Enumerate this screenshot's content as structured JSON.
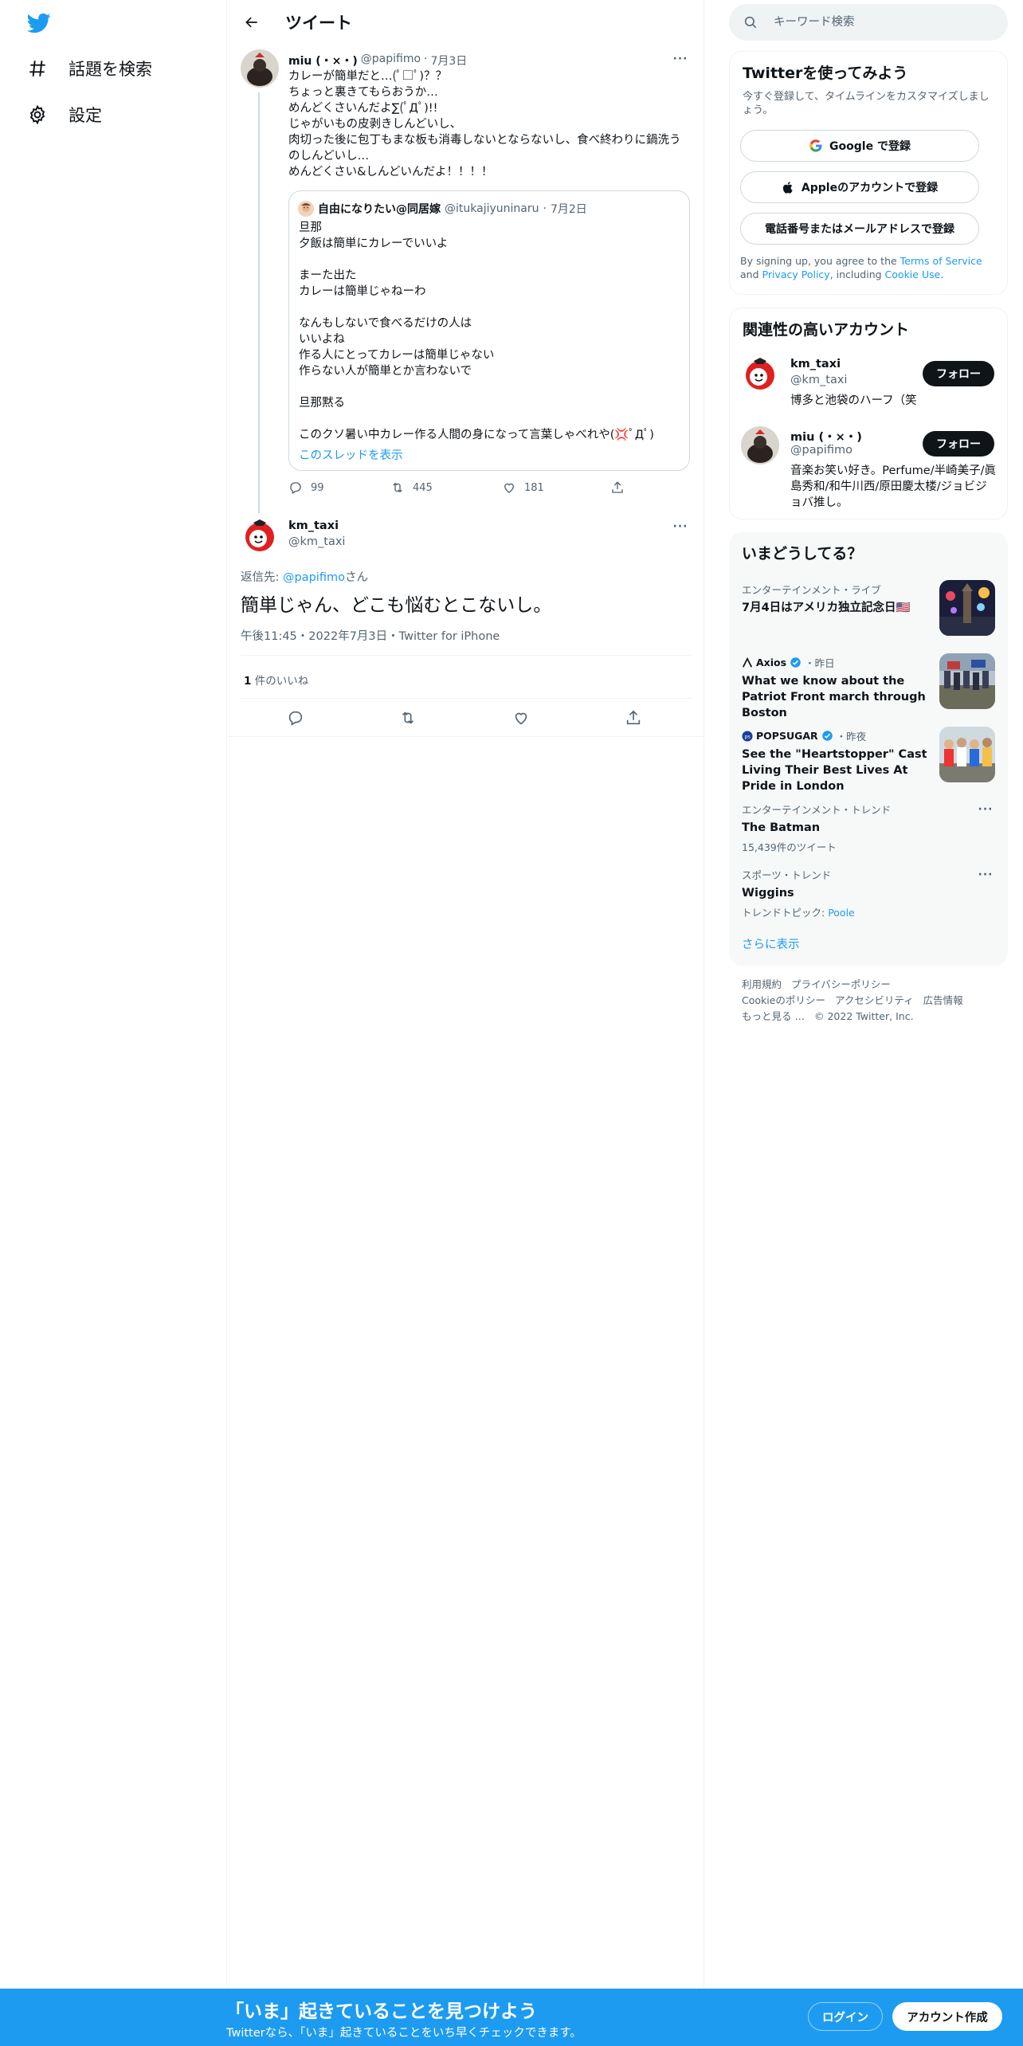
{
  "nav": {
    "explore_label": "話題を検索",
    "settings_label": "設定"
  },
  "header": {
    "title": "ツイート"
  },
  "tweet1": {
    "name": "miu (・×・)",
    "handle": "@papifimo",
    "date": "7月3日",
    "text": "カレーが簡単だと…(ﾟ□ﾟ)？？\nちょっと裏きてもらおうか…\nめんどくさいんだよ∑(ﾟДﾟ)!!\nじゃがいもの皮剥きしんどいし、\n肉切った後に包丁もまな板も消毒しないとならないし、食べ終わりに鍋洗うのしんどいし…\nめんどくさい&しんどいんだよ！！！！",
    "quote": {
      "name": "自由になりたい@同居嫁",
      "handle": "@itukajiyuninaru",
      "date": "7月2日",
      "text": "旦那\n夕飯は簡単にカレーでいいよ\n\nまーた出た\nカレーは簡単じゃねーわ\n\nなんもしないで食べるだけの人は\nいいよね\n作る人にとってカレーは簡単じゃない\n作らない人が簡単とか言わないで\n\n旦那黙る\n\nこのクソ暑い中カレー作る人間の身になって言葉しゃべれや(💢ﾟДﾟ)",
      "show_thread": "このスレッドを表示"
    },
    "replies": "99",
    "retweets": "445",
    "likes": "181"
  },
  "tweet2": {
    "name": "km_taxi",
    "handle": "@km_taxi",
    "reply_prefix": "返信先: ",
    "reply_mention": "@papifimo",
    "reply_suffix": "さん",
    "text": "簡単じゃん、どこも悩むとこないし。",
    "meta": "午後11:45・2022年7月3日・Twitter for iPhone",
    "like_count": "1",
    "like_label": " 件のいいね"
  },
  "search": {
    "placeholder": "キーワード検索"
  },
  "signup": {
    "title": "Twitterを使ってみよう",
    "subtitle": "今すぐ登録して、タイムラインをカスタマイズしましょう。",
    "google": "Google で登録",
    "apple": "Appleのアカウントで登録",
    "phone": "電話番号またはメールアドレスで登録",
    "terms_1": "By signing up, you agree to the ",
    "terms_link1": "Terms of Service",
    "terms_2": " and ",
    "terms_link2": "Privacy Policy",
    "terms_3": ", including ",
    "terms_link3": "Cookie Use",
    "terms_4": "."
  },
  "related": {
    "title": "関連性の高いアカウント",
    "accounts": [
      {
        "name": "km_taxi",
        "handle": "@km_taxi",
        "bio": "博多と池袋のハーフ（笑",
        "follow": "フォロー"
      },
      {
        "name": "miu (・×・)",
        "handle": "@papifimo",
        "bio": "音楽お笑い好き。Perfume/半崎美子/眞島秀和/和牛川西/原田慶太楼/ジョビジョバ推し。",
        "follow": "フォロー"
      }
    ]
  },
  "trends": {
    "title": "いまどうしてる？",
    "items": [
      {
        "meta": "エンターテインメント・ライブ",
        "title": "7月4日はアメリカ独立記念日🇺🇸"
      },
      {
        "source": "Axios",
        "time": "・昨日",
        "title": "What we know about the Patriot Front march through Boston"
      },
      {
        "source": "POPSUGAR",
        "time": "・昨夜",
        "title": "See the \"Heartstopper\" Cast Living Their Best Lives At Pride in London"
      },
      {
        "meta": "エンターテインメント・トレンド",
        "title": "The Batman",
        "sub": "15,439件のツイート"
      },
      {
        "meta": "スポーツ・トレンド",
        "title": "Wiggins",
        "sub_prefix": "トレンドトピック: ",
        "sub_link": "Poole"
      }
    ],
    "show_more": "さらに表示"
  },
  "footer": {
    "links": [
      "利用規約",
      "プライバシーポリシー",
      "Cookieのポリシー",
      "アクセシビリティ",
      "広告情報",
      "もっと見る …"
    ],
    "copyright": "© 2022 Twitter, Inc."
  },
  "bottom": {
    "title": "「いま」起きていることを見つけよう",
    "subtitle": "Twitterなら、「いま」起きていることをいち早くチェックできます。",
    "login": "ログイン",
    "signup": "アカウント作成"
  },
  "colors": {
    "accent": "#1d9bf0",
    "text": "#0f1419",
    "secondary": "#536471"
  }
}
